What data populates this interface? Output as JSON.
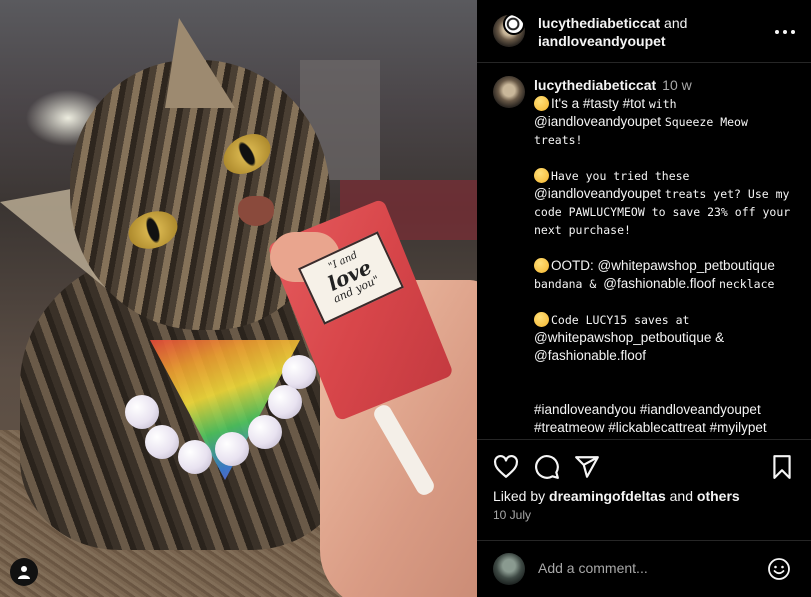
{
  "post": {
    "image_label": {
      "line1": "\"I and",
      "line2": "love",
      "line3": "and you\""
    }
  },
  "header": {
    "user1": "lucythediabeticcat",
    "joiner": "and",
    "user2": "iandloveandyoupet"
  },
  "caption": {
    "username": "lucythediabeticcat",
    "time": "10 w",
    "lines": [
      {
        "parts": [
          [
            "emoji",
            ""
          ],
          [
            "sans",
            "It's a #tasty #tot "
          ],
          [
            "mono",
            "with"
          ]
        ]
      },
      {
        "parts": [
          [
            "sans",
            "@iandloveandyoupet "
          ],
          [
            "mono",
            "Squeeze Meow"
          ]
        ]
      },
      {
        "parts": [
          [
            "mono",
            "treats!"
          ]
        ]
      },
      {
        "gap": true
      },
      {
        "parts": [
          [
            "emoji",
            ""
          ],
          [
            "mono",
            "Have you tried these"
          ]
        ]
      },
      {
        "parts": [
          [
            "sans",
            "@iandloveandyoupet "
          ],
          [
            "mono",
            "treats yet? Use my"
          ]
        ]
      },
      {
        "parts": [
          [
            "mono",
            "code PAWLUCYMEOW to save 23% off your"
          ]
        ]
      },
      {
        "parts": [
          [
            "mono",
            "next purchase!"
          ]
        ]
      },
      {
        "gap": true
      },
      {
        "parts": [
          [
            "emoji",
            ""
          ],
          [
            "sans",
            "OOTD: @whitepawshop_petboutique"
          ]
        ]
      },
      {
        "parts": [
          [
            "mono",
            "bandana & "
          ],
          [
            "sans",
            "@fashionable.floof "
          ],
          [
            "mono",
            "necklace"
          ]
        ]
      },
      {
        "gap": true
      },
      {
        "parts": [
          [
            "emoji",
            ""
          ],
          [
            "mono",
            "Code LUCY15 saves at"
          ]
        ]
      },
      {
        "parts": [
          [
            "sans",
            "@whitepawshop_petboutique &"
          ]
        ]
      },
      {
        "parts": [
          [
            "sans",
            "@fashionable.floof"
          ]
        ]
      },
      {
        "gap": true
      },
      {
        "gap": true
      },
      {
        "parts": [
          [
            "sans",
            "#iandloveandyou #iandloveandyoupet"
          ]
        ]
      },
      {
        "parts": [
          [
            "sans",
            "#treatmeow #lickablecattreat #myilypet"
          ]
        ]
      }
    ]
  },
  "actions": {
    "like": "heart-icon",
    "comment": "comment-icon",
    "share": "share-icon",
    "save": "bookmark-icon"
  },
  "likes": {
    "prefix": "Liked by",
    "user": "dreamingofdeltas",
    "joiner": "and",
    "others": "others"
  },
  "date": "10 July",
  "comment_box": {
    "placeholder": "Add a comment..."
  },
  "colors": {
    "background": "#000000",
    "text": "#f5f5f5",
    "muted": "#a8a8a8",
    "divider": "#262626"
  }
}
